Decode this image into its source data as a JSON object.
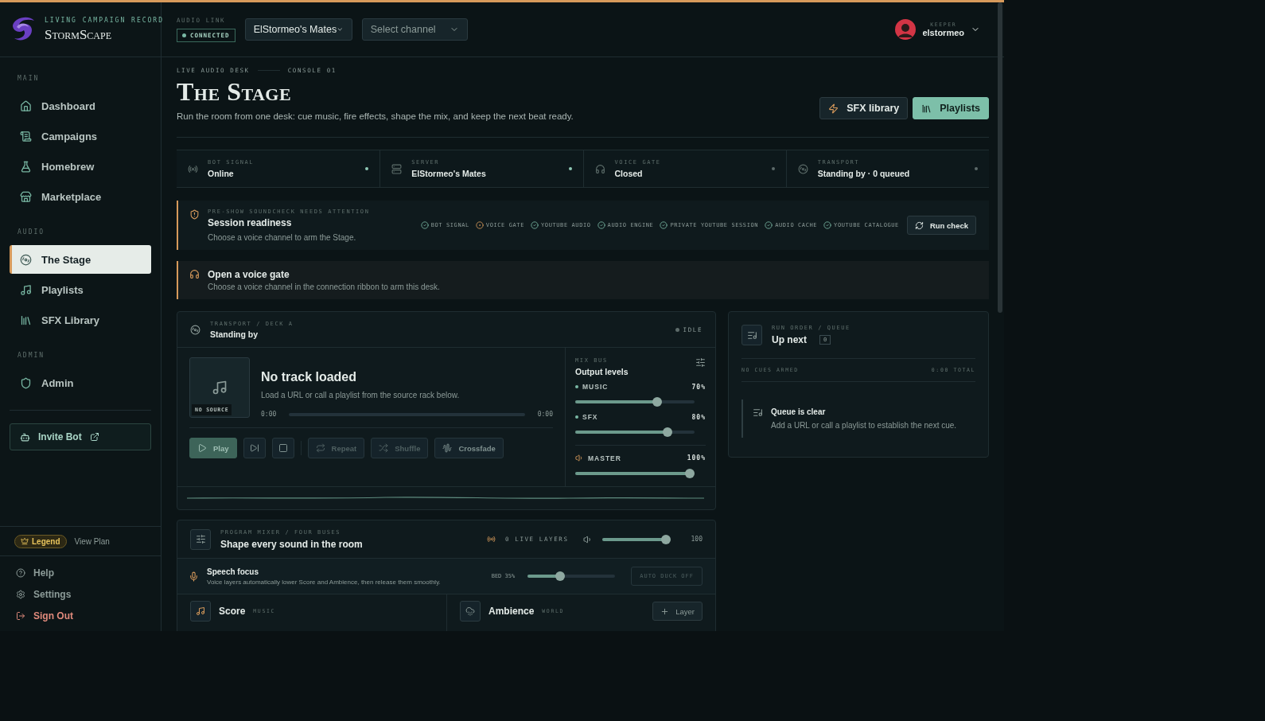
{
  "brand": {
    "tagline": "LIVING CAMPAIGN RECORD",
    "name": "StormScape"
  },
  "sidebar": {
    "sections": [
      {
        "label": "MAIN",
        "items": [
          {
            "label": "Dashboard",
            "selected": false
          },
          {
            "label": "Campaigns",
            "selected": false
          },
          {
            "label": "Homebrew",
            "selected": false
          },
          {
            "label": "Marketplace",
            "selected": false
          }
        ]
      },
      {
        "label": "AUDIO",
        "items": [
          {
            "label": "The Stage",
            "selected": true
          },
          {
            "label": "Playlists",
            "selected": false
          },
          {
            "label": "SFX Library",
            "selected": false
          }
        ]
      },
      {
        "label": "ADMIN",
        "items": [
          {
            "label": "Admin",
            "selected": false
          }
        ]
      }
    ],
    "invite_button": "Invite Bot",
    "plan": {
      "badge": "Legend",
      "link": "View Plan"
    },
    "footer_items": [
      {
        "label": "Help",
        "kind": "normal"
      },
      {
        "label": "Settings",
        "kind": "normal"
      },
      {
        "label": "Sign Out",
        "kind": "danger"
      }
    ]
  },
  "topbar": {
    "audio_link": {
      "label": "AUDIO LINK",
      "status": "CONNECTED"
    },
    "selects": [
      {
        "value": "ElStormeo's Mates"
      },
      {
        "placeholder": "Select channel"
      }
    ],
    "user": {
      "role": "KEEPER",
      "name": "elstormeo"
    }
  },
  "header": {
    "eyebrow": [
      "LIVE AUDIO DESK",
      "CONSOLE 01"
    ],
    "title": "The Stage",
    "subtitle": "Run the room from one desk: cue music, fire effects, shape the mix, and keep the next beat ready.",
    "actions": [
      {
        "label": "SFX library",
        "primary": false
      },
      {
        "label": "Playlists",
        "primary": true
      }
    ]
  },
  "status_strip": [
    {
      "label": "BOT SIGNAL",
      "value": "Online",
      "active": true
    },
    {
      "label": "SERVER",
      "value": "ElStormeo's Mates",
      "active": true
    },
    {
      "label": "VOICE GATE",
      "value": "Closed",
      "active": false
    },
    {
      "label": "TRANSPORT",
      "value": "Standing by · 0 queued",
      "active": false
    }
  ],
  "soundcheck": {
    "eyebrow": "PRE-SHOW SOUNDCHECK NEEDS ATTENTION",
    "title": "Session readiness",
    "text": "Choose a voice channel to arm the Stage.",
    "checks": [
      {
        "label": "BOT SIGNAL",
        "passed": true
      },
      {
        "label": "VOICE GATE",
        "passed": false
      },
      {
        "label": "YOUTUBE AUDIO",
        "passed": true
      },
      {
        "label": "AUDIO ENGINE",
        "passed": true
      },
      {
        "label": "PRIVATE YOUTUBE SESSION",
        "passed": true
      },
      {
        "label": "AUDIO CACHE",
        "passed": true
      },
      {
        "label": "YOUTUBE CATALOGUE",
        "passed": true
      }
    ],
    "button": "Run check"
  },
  "alert": {
    "title": "Open a voice gate",
    "text": "Choose a voice channel in the connection ribbon to arm this desk."
  },
  "transport": {
    "eyebrow": "TRANSPORT / DECK A",
    "title": "Standing by",
    "status": "IDLE",
    "track": {
      "title": "No track loaded",
      "text": "Load a URL or call a playlist from the source rack below.",
      "source_badge": "NO SOURCE",
      "elapsed": "0:00",
      "duration": "0:00",
      "level": 0
    },
    "controls": [
      {
        "kind": "play",
        "label": "Play",
        "disabled": false
      },
      {
        "kind": "next",
        "disabled": false
      },
      {
        "kind": "stop",
        "disabled": false
      },
      {
        "kind": "repeat",
        "label": "Repeat",
        "disabled": true
      },
      {
        "kind": "shuffle",
        "label": "Shuffle",
        "disabled": true
      },
      {
        "kind": "crossfade",
        "label": "Crossfade",
        "disabled": false
      }
    ],
    "mix": {
      "eyebrow": "MIX BUS",
      "title": "Output levels",
      "channels": [
        {
          "kind": "bus",
          "name": "MUSIC",
          "reading": "70%",
          "level": 0.7
        },
        {
          "kind": "bus",
          "name": "SFX",
          "reading": "80%",
          "level": 0.8
        },
        {
          "kind": "master",
          "name": "MASTER",
          "reading": "100%",
          "level": 1
        }
      ]
    }
  },
  "queue": {
    "eyebrow": "RUN ORDER / QUEUE",
    "title": "Up next",
    "count": "0",
    "summary_left": "NO CUES ARMED",
    "summary_right": "0:00 TOTAL",
    "empty_title": "Queue is clear",
    "empty_text": "Add a URL or call a playlist to establish the next cue."
  },
  "mixer": {
    "eyebrow": "PROGRAM MIXER / FOUR BUSES",
    "title": "Shape every sound in the room",
    "live_layers": "0 LIVE LAYERS",
    "master": {
      "level": 1,
      "reading": "100"
    },
    "speech_focus": {
      "title": "Speech focus",
      "text": "Voice layers automatically lower Score and Ambience, then release them smoothly.",
      "reading": "BED 35%",
      "level": 0.35,
      "button": "AUTO DUCK OFF"
    },
    "buses": [
      {
        "kind": "music",
        "name": "Score",
        "tag": "MUSIC"
      },
      {
        "kind": "world",
        "name": "Ambience",
        "tag": "WORLD",
        "action": "Layer"
      }
    ]
  }
}
